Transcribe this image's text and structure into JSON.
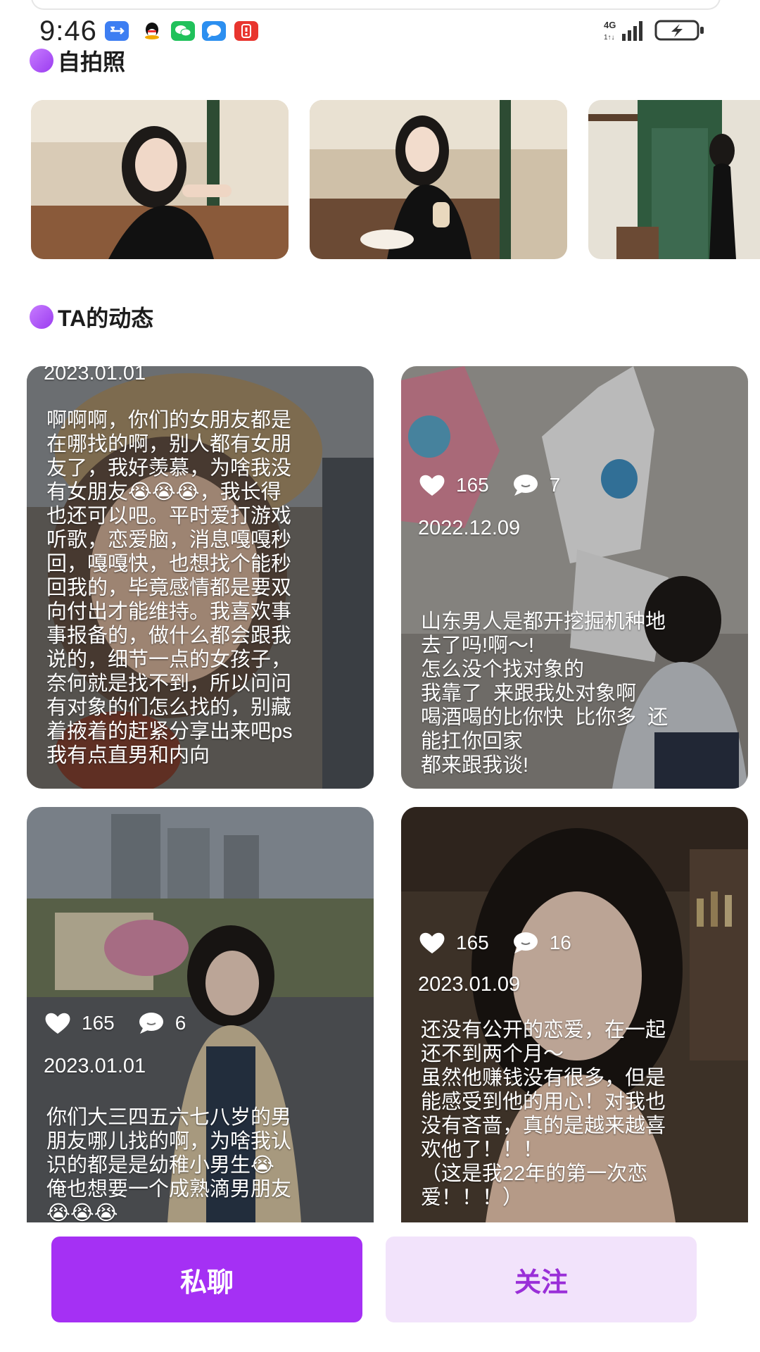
{
  "status_bar": {
    "time": "9:46",
    "network": "4G"
  },
  "sections": {
    "selfies_title": "自拍照",
    "feed_title": "TA的动态"
  },
  "selfies": [
    {
      "icon": "selfie-photo-1"
    },
    {
      "icon": "selfie-photo-2"
    },
    {
      "icon": "selfie-photo-3"
    }
  ],
  "feed": [
    {
      "date": "2023.01.01",
      "text": "啊啊啊，你们的女朋友都是\n在哪找的啊，别人都有女朋\n友了，我好羡慕，为啥我没\n有女朋友😭😭😭，我长得\n也还可以吧。平时爱打游戏\n听歌，恋爱脑，消息嘎嘎秒\n回，嘎嘎快，也想找个能秒\n回我的，毕竟感情都是要双\n向付出才能维持。我喜欢事\n事报备的，做什么都会跟我\n说的，细节一点的女孩子，\n奈何就是找不到，所以问问\n有对象的们怎么找的，别藏\n着掖着的赶紧分享出来吧ps\n我有点直男和内向"
    },
    {
      "likes": "165",
      "comments": "7",
      "date": "2022.12.09",
      "text": "山东男人是都开挖掘机种地\n去了吗!啊～!\n怎么没个找对象的\n我靠了  来跟我处对象啊\n喝酒喝的比你快  比你多  还\n能扛你回家\n都来跟我谈!"
    },
    {
      "likes": "165",
      "comments": "6",
      "date": "2023.01.01",
      "text": "你们大三四五六七八岁的男\n朋友哪儿找的啊，为啥我认\n识的都是是幼稚小男生😭\n俺也想要一个成熟滴男朋友\n😭😭😭"
    },
    {
      "likes": "165",
      "comments": "16",
      "date": "2023.01.09",
      "text": "还没有公开的恋爱，在一起\n还不到两个月～\n虽然他赚钱没有很多，但是\n能感受到他的用心！对我也\n没有吝啬，真的是越来越喜\n欢他了！！！\n（这是我22年的第一次恋\n爱！！！）"
    }
  ],
  "actions": {
    "chat_label": "私聊",
    "follow_label": "关注"
  },
  "colors": {
    "accent": "#a530f4",
    "follow_bg": "#f2e3fb",
    "follow_text": "#9a2fd8"
  }
}
